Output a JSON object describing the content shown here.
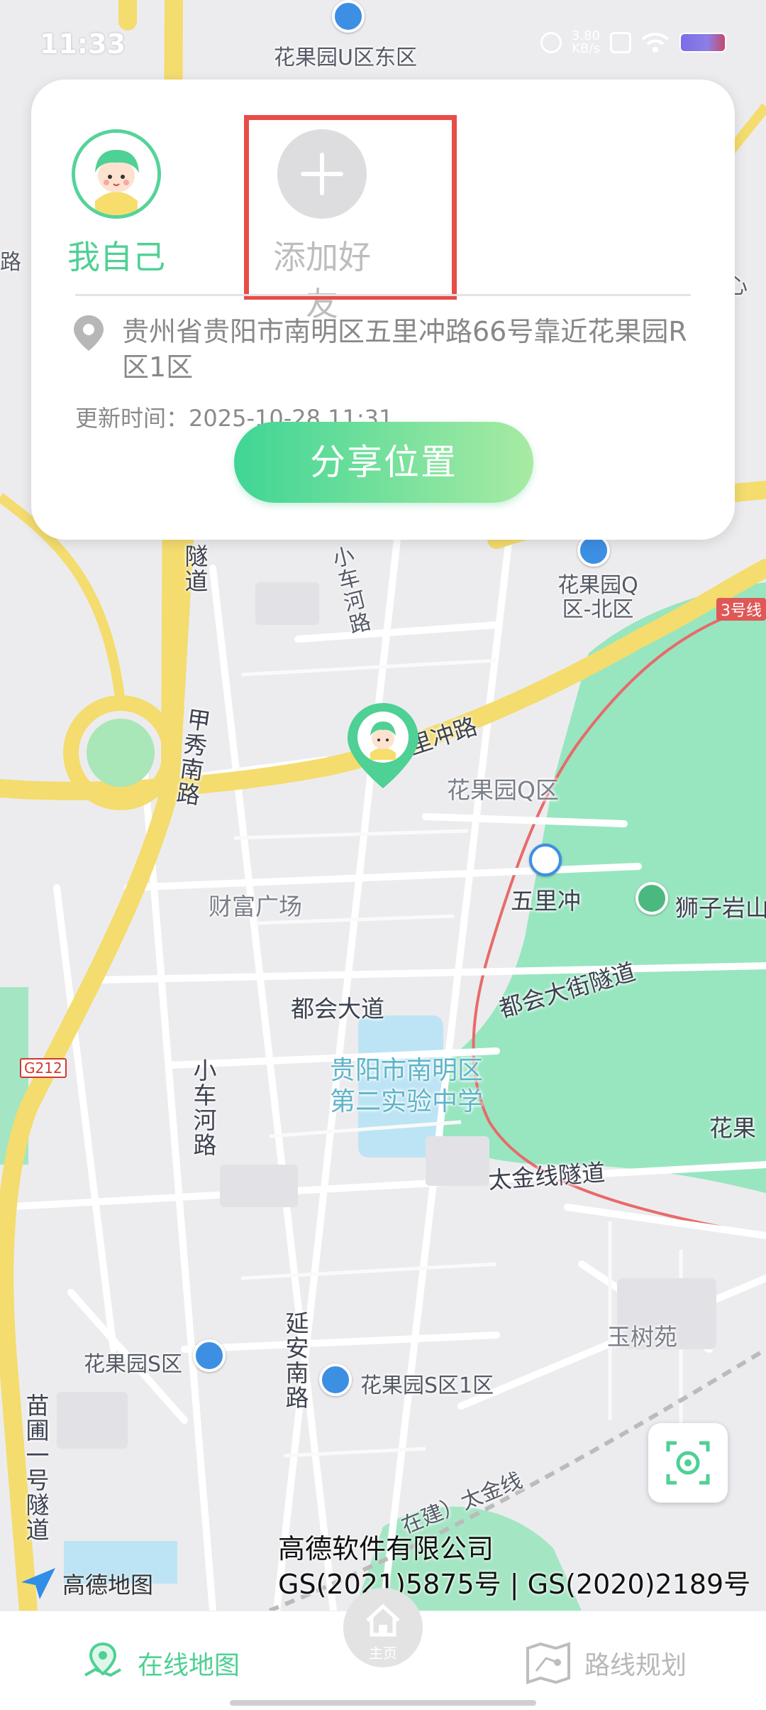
{
  "status_bar": {
    "time": "11:33",
    "net_speed_value": "3.80",
    "net_speed_unit": "KB/s"
  },
  "card": {
    "members": [
      {
        "label": "我自己"
      },
      {
        "label": "添加好友"
      }
    ],
    "address": "贵州省贵阳市南明区五里冲路66号靠近花果园R区1区",
    "update_time": "更新时间：2025-10-28 11:31",
    "share_button": "分享位置"
  },
  "map": {
    "labels": {
      "u_east": "花果园U区东区",
      "tunnel_left": "隧道",
      "xiaochehe_top": "小车河路",
      "q_north": "花果园Q区-北区",
      "line3": "3号线",
      "jiaxiu": "甲秀南路",
      "wulichong_road": "里冲路",
      "q_area": "花果园Q区",
      "caifu": "财富广场",
      "wulichong_station": "五里冲",
      "shiziyan": "狮子岩山",
      "duhui": "都会大道",
      "duhui_tunnel": "都会大街隧道",
      "school": "贵阳市南明区第二实验中学",
      "huaguoyuan_right": "花果",
      "xiaochehe_bottom": "小车河路",
      "taijin": "太金线隧道",
      "yushu": "玉树苑",
      "s_area": "花果园S区",
      "s_area_1": "花果园S区1区",
      "yanan": "延安南路",
      "miaopu": "苗圃一号隧道",
      "taijin_building": "在建）太金线",
      "g212": "G212",
      "road_left": "路",
      "xin": "心"
    },
    "colors": {
      "main_road": "#f4dc6e",
      "park": "#97e6c0",
      "water": "#bde4f4",
      "metro_line": "#e86a6a"
    }
  },
  "attribution": {
    "logo_text": "高德地图",
    "company": "高德软件有限公司",
    "license": "GS(2021)5875号 | GS(2020)2189号"
  },
  "nav": {
    "map_label": "在线地图",
    "home_label": "主页",
    "route_label": "路线规划"
  },
  "accent_color": "#4fd095"
}
